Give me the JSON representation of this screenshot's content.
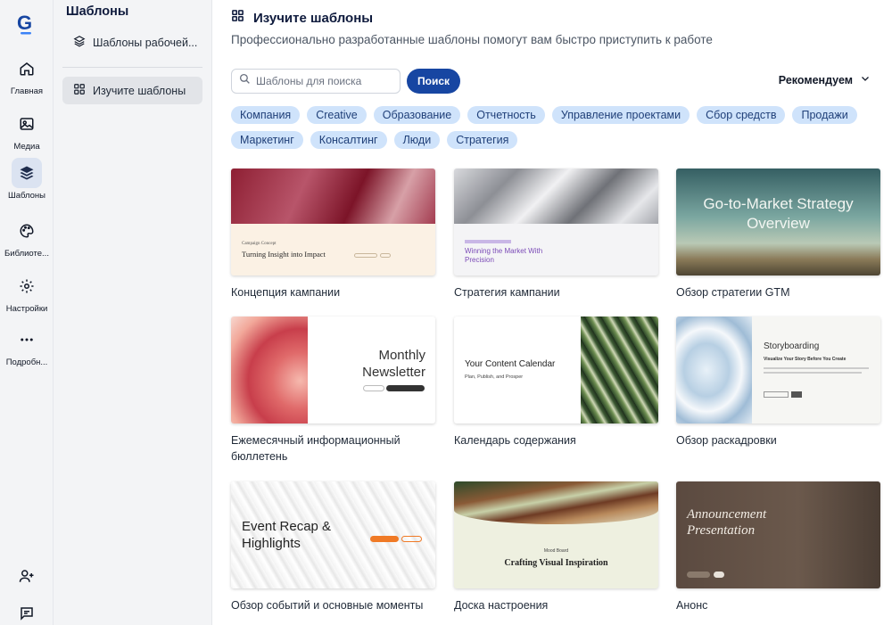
{
  "rail": {
    "items": [
      {
        "label": "Главная",
        "icon": "home-icon"
      },
      {
        "label": "Медиа",
        "icon": "image-icon"
      },
      {
        "label": "Шаблоны",
        "icon": "layers-icon"
      },
      {
        "label": "Библиоте...",
        "icon": "palette-icon"
      },
      {
        "label": "Настройки",
        "icon": "gear-icon"
      },
      {
        "label": "Подробн...",
        "icon": "more-icon"
      }
    ]
  },
  "subnav": {
    "title": "Шаблоны",
    "items": [
      {
        "label": "Шаблоны рабочей..."
      },
      {
        "label": "Изучите шаблоны"
      }
    ]
  },
  "main": {
    "title": "Изучите шаблоны",
    "subtitle": "Профессионально разработанные шаблоны помогут вам быстро приступить к работе",
    "search_placeholder": "Шаблоны для поиска",
    "search_button": "Поиск",
    "sort_label": "Рекомендуем",
    "chips_row1": [
      "Компания",
      "Creative",
      "Образование",
      "Отчетность",
      "Управление проектами",
      "Сбор средств",
      "Продажи"
    ],
    "chips_row2": [
      "Маркетинг",
      "Консалтинг",
      "Люди",
      "Стратегия"
    ],
    "cards": [
      {
        "caption": "Концепция кампании",
        "thumb_title": "Turning Insight into Impact",
        "thumb_kicker": "Campaign Concept"
      },
      {
        "caption": "Стратегия кампании",
        "thumb_title": "Winning the Market With Precision"
      },
      {
        "caption": "Обзор стратегии GTM",
        "thumb_title": "Go-to-Market Strategy Overview"
      },
      {
        "caption": "Ежемесячный информационный бюллетень",
        "thumb_title": "Monthly Newsletter"
      },
      {
        "caption": "Календарь содержания",
        "thumb_title": "Your Content Calendar",
        "thumb_sub": "Plan, Publish, and Prosper"
      },
      {
        "caption": "Обзор раскадровки",
        "thumb_title": "Storyboarding",
        "thumb_sub": "Visualize Your Story Before You Create"
      },
      {
        "caption": "Обзор событий и основные моменты",
        "thumb_title": "Event Recap & Highlights"
      },
      {
        "caption": "Доска настроения",
        "thumb_title": "Crafting Visual Inspiration",
        "thumb_kicker": "Mood Board"
      },
      {
        "caption": "Анонс",
        "thumb_title": "Announcement Presentation"
      }
    ]
  },
  "colors": {
    "accent": "#1746a2",
    "chip_bg": "#cfe3fb",
    "nav_bg": "#f3f4f6"
  }
}
